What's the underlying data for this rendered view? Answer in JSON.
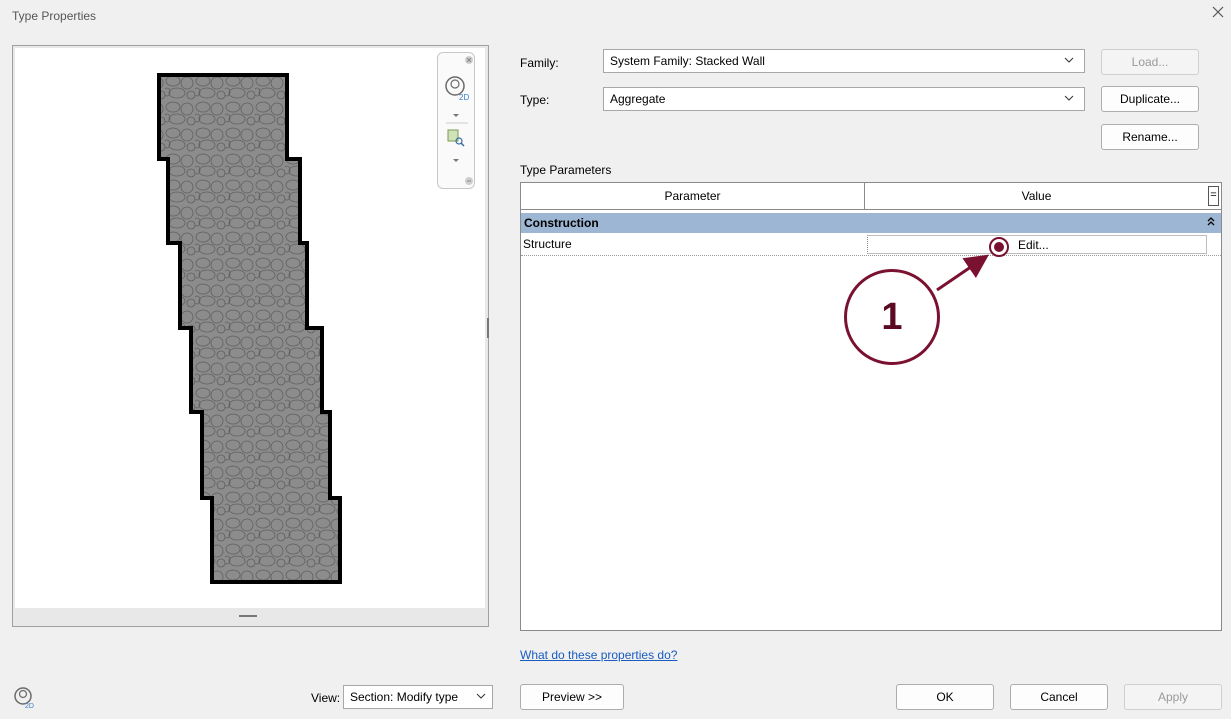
{
  "window": {
    "title": "Type Properties",
    "close_icon": "close-icon"
  },
  "family": {
    "label": "Family:",
    "value": "System Family: Stacked Wall"
  },
  "type": {
    "label": "Type:",
    "value": "Aggregate"
  },
  "buttons": {
    "load": "Load...",
    "duplicate": "Duplicate...",
    "rename": "Rename...",
    "preview": "Preview >>",
    "ok": "OK",
    "cancel": "Cancel",
    "apply": "Apply"
  },
  "type_parameters": {
    "heading": "Type Parameters",
    "columns": {
      "parameter": "Parameter",
      "value": "Value",
      "eq": "="
    },
    "group": {
      "name": "Construction",
      "collapse_glyph": "»"
    },
    "rows": [
      {
        "name": "Structure",
        "value": "Edit..."
      }
    ]
  },
  "help_link": "What do these properties do?",
  "view": {
    "label": "View:",
    "value": "Section: Modify type"
  },
  "annotation": {
    "number": "1",
    "color": "#7a1130"
  },
  "colors": {
    "group_header": "#9db6d3",
    "link": "#1a5bbf"
  }
}
